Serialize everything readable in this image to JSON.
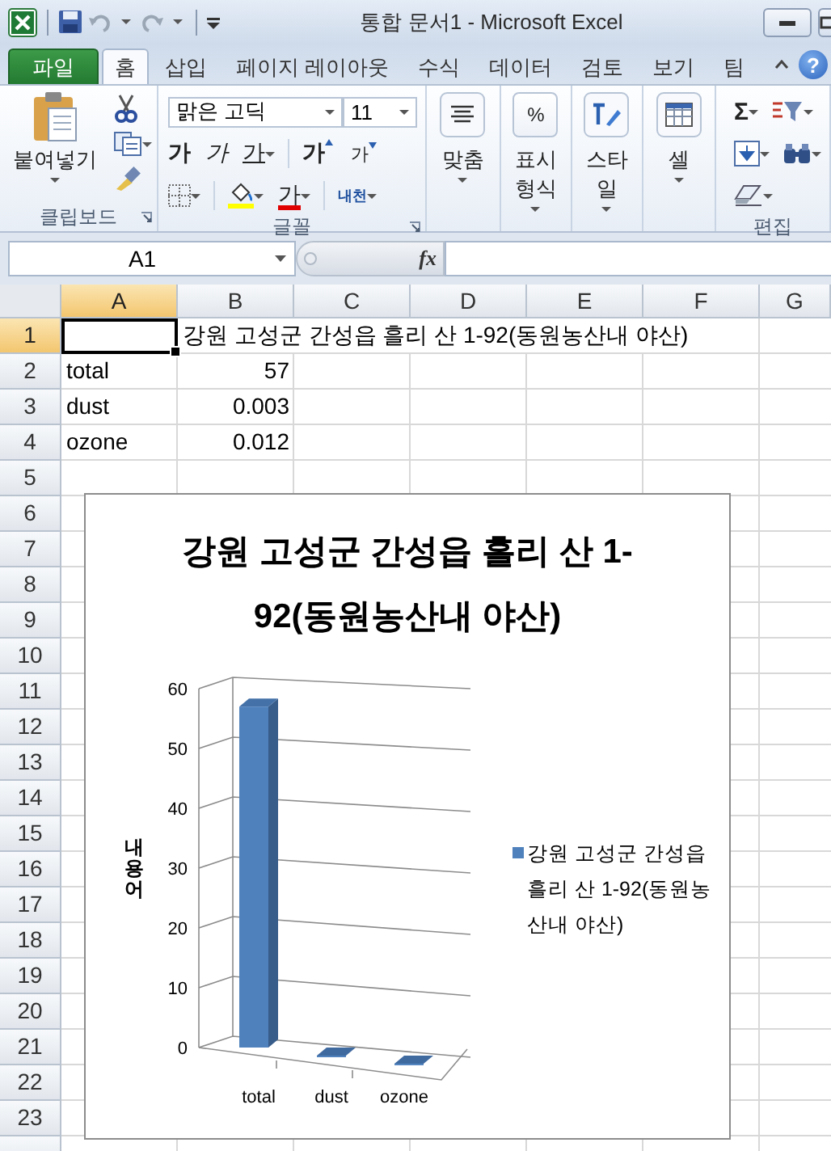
{
  "window": {
    "title": "통합 문서1  -  Microsoft Excel"
  },
  "ribbon_tabs": [
    {
      "label": "파일",
      "kind": "file",
      "selected": false
    },
    {
      "label": "홈",
      "kind": "tab",
      "selected": true
    },
    {
      "label": "삽입",
      "kind": "tab",
      "selected": false
    },
    {
      "label": "페이지 레이아웃",
      "kind": "tab",
      "selected": false
    },
    {
      "label": "수식",
      "kind": "tab",
      "selected": false
    },
    {
      "label": "데이터",
      "kind": "tab",
      "selected": false
    },
    {
      "label": "검토",
      "kind": "tab",
      "selected": false
    },
    {
      "label": "보기",
      "kind": "tab",
      "selected": false
    },
    {
      "label": "팀",
      "kind": "tab",
      "selected": false
    }
  ],
  "help": "?",
  "ribbon": {
    "clipboard": {
      "paste": "붙여넣기",
      "label": "클립보드"
    },
    "font": {
      "name": "맑은 고딕",
      "size": "11",
      "label": "글꼴",
      "row_1": [
        {
          "kind": "bold",
          "text": "가"
        },
        {
          "kind": "italic",
          "text": "가"
        },
        {
          "kind": "underline",
          "text": "가"
        },
        {
          "kind": "grow",
          "text": "가"
        },
        {
          "kind": "shrink",
          "text": "가"
        }
      ],
      "row_2": [
        {
          "kind": "borders"
        },
        {
          "kind": "fill"
        },
        {
          "kind": "font_color",
          "text": "가"
        },
        {
          "kind": "phonetic",
          "text": "내천"
        }
      ]
    },
    "large_buttons": [
      {
        "kind": "align",
        "label": "맞춤"
      },
      {
        "kind": "number",
        "label": "표시 형식",
        "icon_text": "%"
      },
      {
        "kind": "styles",
        "label": "스타일"
      },
      {
        "kind": "cells",
        "label": "셀"
      }
    ],
    "editing": {
      "label": "편집",
      "autosum": "Σ"
    }
  },
  "formula_bar": {
    "name_box": "A1",
    "function_label": "fx"
  },
  "sheet": {
    "columns": [
      {
        "label": "A",
        "selected": true
      },
      {
        "label": "B",
        "selected": false
      },
      {
        "label": "C",
        "selected": false
      },
      {
        "label": "D",
        "selected": false
      },
      {
        "label": "E",
        "selected": false
      },
      {
        "label": "F",
        "selected": false
      },
      {
        "label": "G",
        "selected": false
      }
    ],
    "rows": [
      {
        "label": "1",
        "selected": true,
        "cells": [
          {
            "kind": "blank",
            "selected": true
          },
          {
            "kind": "text",
            "value": "강원 고성군 간성읍 흘리 산 1-92(동원농산내 야산)",
            "selected": false
          }
        ]
      },
      {
        "label": "2",
        "selected": false,
        "cells": [
          {
            "kind": "text",
            "value": "total",
            "selected": false
          },
          {
            "kind": "number",
            "value": "57",
            "selected": false
          }
        ]
      },
      {
        "label": "3",
        "selected": false,
        "cells": [
          {
            "kind": "text",
            "value": "dust",
            "selected": false
          },
          {
            "kind": "number",
            "value": "0.003",
            "selected": false
          }
        ]
      },
      {
        "label": "4",
        "selected": false,
        "cells": [
          {
            "kind": "text",
            "value": "ozone",
            "selected": false
          },
          {
            "kind": "number",
            "value": "0.012",
            "selected": false
          }
        ]
      },
      {
        "label": "5",
        "selected": false
      },
      {
        "label": "6",
        "selected": false
      },
      {
        "label": "7",
        "selected": false
      },
      {
        "label": "8",
        "selected": false
      },
      {
        "label": "9",
        "selected": false
      },
      {
        "label": "10",
        "selected": false
      },
      {
        "label": "11",
        "selected": false
      },
      {
        "label": "12",
        "selected": false
      },
      {
        "label": "13",
        "selected": false
      },
      {
        "label": "14",
        "selected": false
      },
      {
        "label": "15",
        "selected": false
      },
      {
        "label": "16",
        "selected": false
      },
      {
        "label": "17",
        "selected": false
      },
      {
        "label": "18",
        "selected": false
      },
      {
        "label": "19",
        "selected": false
      },
      {
        "label": "20",
        "selected": false
      },
      {
        "label": "21",
        "selected": false
      },
      {
        "label": "22",
        "selected": false
      },
      {
        "label": "23",
        "selected": false
      }
    ],
    "chart": {
      "chart_data": {
        "type": "bar",
        "title": "강원 고성군 간성읍 흘리 산 1-92(동원농산내 야산)",
        "ylabel": "내용어",
        "categories": [
          "total",
          "dust",
          "ozone"
        ],
        "series": [
          {
            "name": "강원 고성군 간성읍 흘리 산 1-92(동원농산내 야산)",
            "color": "#4f81bd",
            "values": [
              57,
              0.003,
              0.012
            ]
          }
        ],
        "ylim": [
          0,
          60
        ],
        "yticks": [
          0,
          10,
          20,
          30,
          40,
          50,
          60
        ]
      }
    }
  }
}
